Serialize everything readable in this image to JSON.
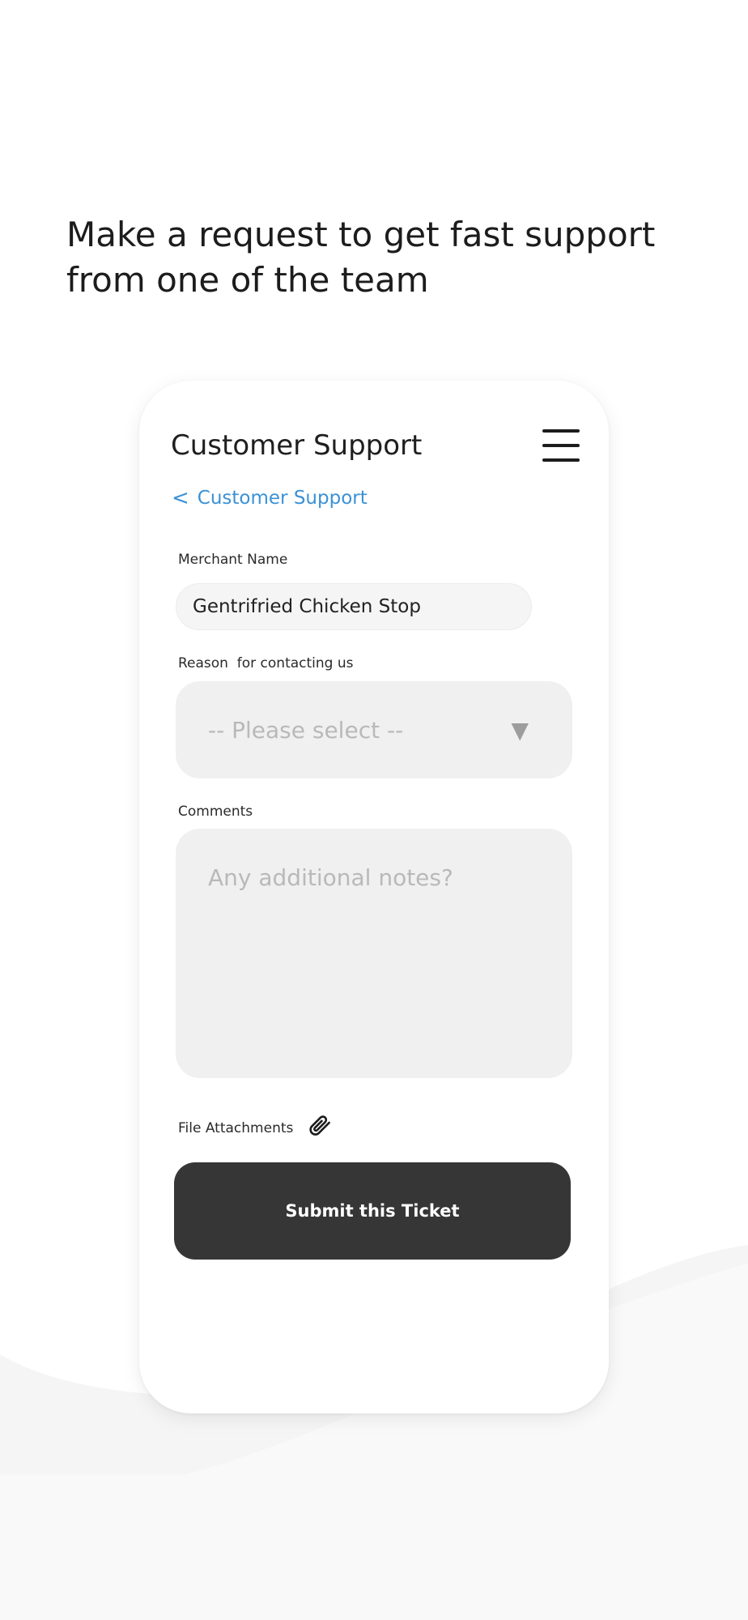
{
  "headline": "Make a request to get fast support from one of the team",
  "app": {
    "title": "Customer Support",
    "menu_icon": "hamburger-menu-icon"
  },
  "breadcrumb": {
    "chevron": "<",
    "label": "Customer Support"
  },
  "form": {
    "merchant_label": "Merchant Name",
    "merchant_value": "Gentrifried Chicken Stop",
    "reason_label": "Reason  for contacting us",
    "reason_placeholder": "-- Please select --",
    "reason_caret": "▼",
    "comments_label": "Comments",
    "comments_placeholder": "Any additional notes?",
    "attachments_label": "File Attachments",
    "attachments_icon": "paperclip-icon",
    "submit_label": "Submit this Ticket"
  },
  "colors": {
    "accent_link": "#3b91d6",
    "button_bg": "#363636",
    "field_bg": "#f0f0f0",
    "placeholder": "#b9b9b9"
  }
}
